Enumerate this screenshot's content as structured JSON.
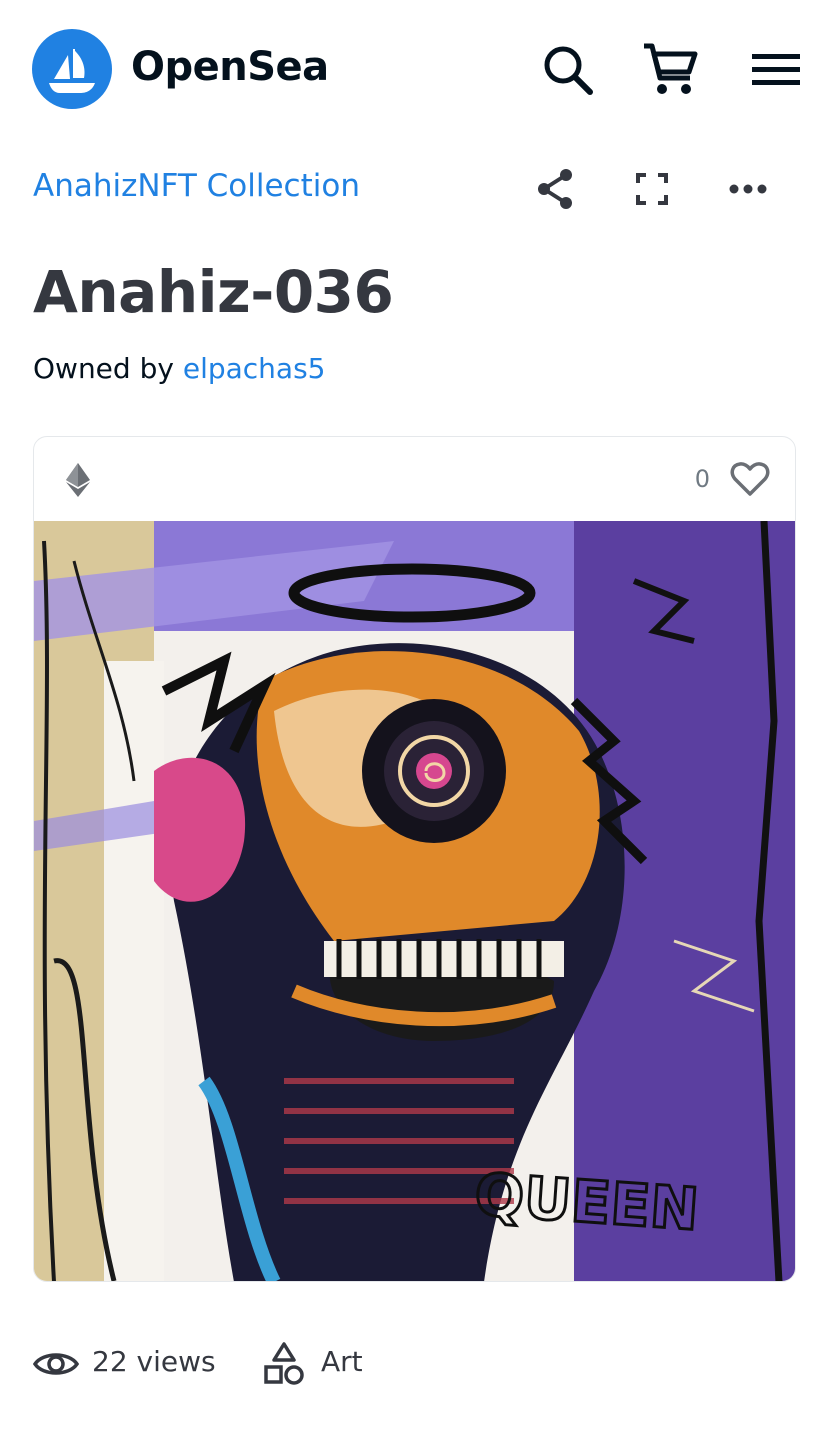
{
  "header": {
    "brand": "OpenSea",
    "icons": [
      "opensea-logo-icon",
      "search-icon",
      "cart-icon",
      "menu-icon"
    ]
  },
  "collection": {
    "name": "AnahizNFT Collection"
  },
  "actions": [
    "share-icon",
    "fullscreen-icon",
    "more-icon"
  ],
  "item": {
    "title": "Anahiz-036",
    "owned_by_label": "Owned by",
    "owner": "elpachas5",
    "like_count": "0",
    "artwork_signature": "QUEEN"
  },
  "stats": {
    "views": "22 views",
    "category": "Art"
  },
  "colors": {
    "accent": "#2081e2",
    "text_dark": "#353840",
    "border": "#e5e8eb",
    "art_purple": "#5b3fa0",
    "art_lavender": "#8b78d6",
    "art_tan": "#cdb883",
    "art_orange": "#e0892a"
  }
}
